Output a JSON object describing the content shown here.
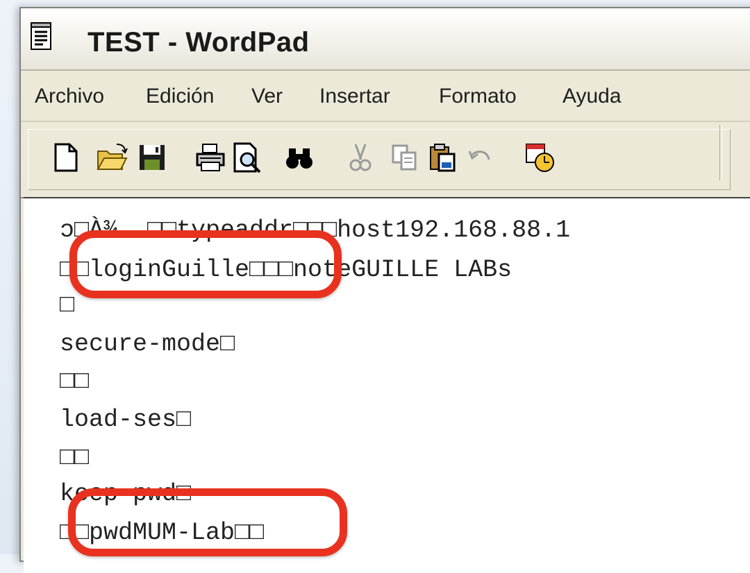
{
  "window": {
    "title": "TEST - WordPad",
    "icon": "wordpad-document-icon"
  },
  "menu": [
    {
      "label": "Archivo"
    },
    {
      "label": "Edición"
    },
    {
      "label": "Ver"
    },
    {
      "label": "Insertar"
    },
    {
      "label": "Formato"
    },
    {
      "label": "Ayuda"
    }
  ],
  "toolbar": {
    "buttons": [
      {
        "icon": "new-document-icon"
      },
      {
        "icon": "open-folder-icon"
      },
      {
        "icon": "save-disk-icon"
      },
      {
        "icon": "print-icon"
      },
      {
        "icon": "print-preview-icon"
      },
      {
        "icon": "find-binoculars-icon"
      },
      {
        "icon": "cut-scissors-icon",
        "disabled": true
      },
      {
        "icon": "copy-icon",
        "disabled": true
      },
      {
        "icon": "paste-icon"
      },
      {
        "icon": "undo-icon",
        "disabled": true
      },
      {
        "icon": "date-time-icon"
      }
    ]
  },
  "document": {
    "lines": [
      "ɔ□À¾  □□typeaddr□□□host192.168.88.1",
      "□□loginGuille□□□noteGUILLE LABs",
      "□",
      "secure-mode□",
      "□□",
      "load-ses□",
      "□□",
      "keep-pwd□",
      "□□pwdMUM-Lab□□"
    ]
  },
  "annotations": {
    "color": "#e8321f"
  }
}
